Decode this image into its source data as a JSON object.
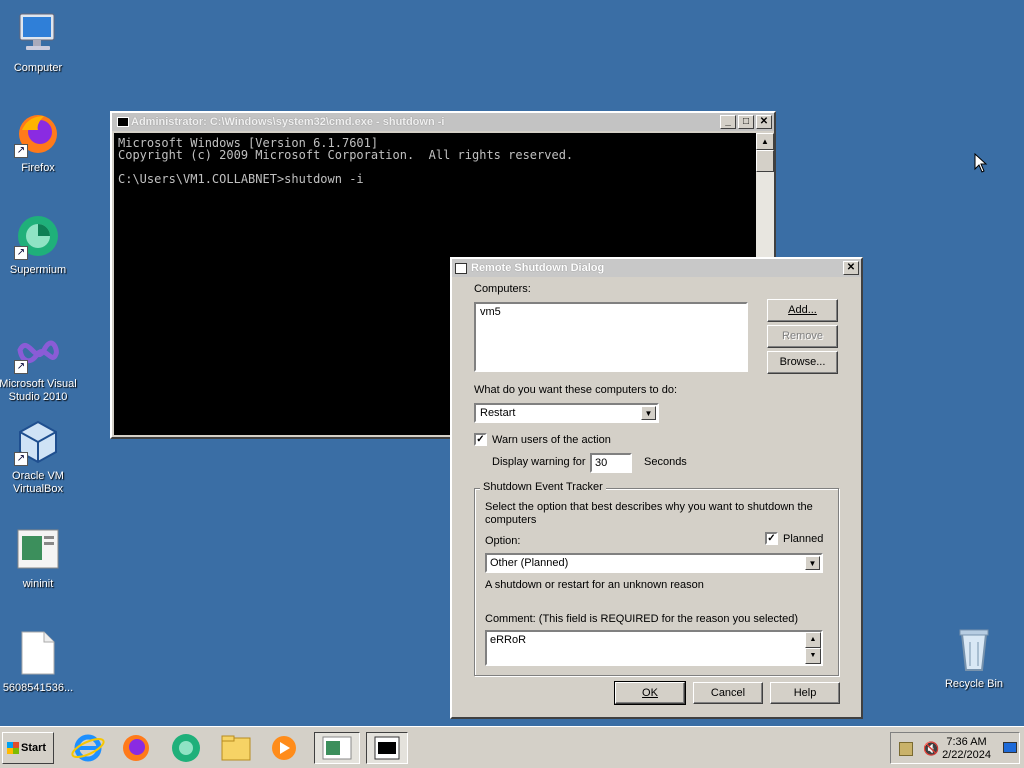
{
  "desktop": {
    "icons": [
      {
        "label": "Computer",
        "icon": "computer-icon"
      },
      {
        "label": "Firefox",
        "icon": "firefox-icon"
      },
      {
        "label": "Supermium",
        "icon": "supermium-icon"
      },
      {
        "label": "Microsoft Visual Studio 2010",
        "icon": "visual-studio-icon"
      },
      {
        "label": "Oracle VM VirtualBox",
        "icon": "virtualbox-icon"
      },
      {
        "label": "wininit",
        "icon": "wininit-icon"
      },
      {
        "label": "5608541536...",
        "icon": "file-icon"
      },
      {
        "label": "Recycle Bin",
        "icon": "recycle-bin-icon"
      }
    ]
  },
  "cmd": {
    "title": "Administrator: C:\\Windows\\system32\\cmd.exe - shutdown  -i",
    "lines": [
      "Microsoft Windows [Version 6.1.7601]",
      "Copyright (c) 2009 Microsoft Corporation.  All rights reserved.",
      "",
      "C:\\Users\\VM1.COLLABNET>shutdown -i"
    ]
  },
  "dialog": {
    "title": "Remote Shutdown Dialog",
    "computers_label": "Computers:",
    "computers": [
      "vm5"
    ],
    "add_label": "Add...",
    "remove_label": "Remove",
    "browse_label": "Browse...",
    "action_label": "What do you want these computers to do:",
    "action_value": "Restart",
    "warn_label": "Warn users of the action",
    "warn_checked": true,
    "display_warning_label": "Display warning for",
    "display_warning_value": "30",
    "seconds_label": "Seconds",
    "tracker_title": "Shutdown Event Tracker",
    "tracker_desc": "Select the option that best describes why you want to shutdown the computers",
    "option_label": "Option:",
    "planned_label": "Planned",
    "planned_checked": true,
    "option_value": "Other (Planned)",
    "option_desc": "A shutdown or restart for an unknown reason",
    "comment_label": "Comment: (This field is REQUIRED for the reason you selected)",
    "comment_value": "eRRoR",
    "ok_label": "OK",
    "cancel_label": "Cancel",
    "help_label": "Help"
  },
  "taskbar": {
    "start_label": "Start",
    "apps": [
      "internet-explorer-icon",
      "firefox-icon",
      "supermium-icon",
      "file-explorer-icon",
      "media-player-icon",
      "wininit-icon",
      "cmd-app-icon"
    ],
    "time": "7:36 AM",
    "date": "2/22/2024"
  },
  "colors": {
    "desktop": "#3a6ea5",
    "window_face": "#d4d0c8"
  }
}
